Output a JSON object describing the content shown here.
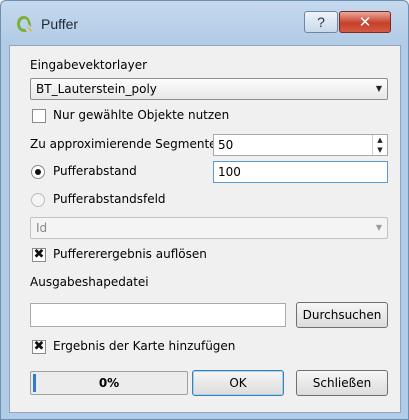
{
  "window": {
    "title": "Puffer",
    "help_label": "?",
    "close_label": "✕",
    "app_icon": "qgis-logo-icon"
  },
  "form": {
    "input_layer_label": "Eingabevektorlayer",
    "input_layer_value": "BT_Lauterstein_poly",
    "selected_only_label": "Nur gewählte Objekte nutzen",
    "selected_only_checked": false,
    "segments_label": "Zu approximierende Segmente",
    "segments_value": "50",
    "buffer_distance_label": "Pufferabstand",
    "buffer_distance_selected": true,
    "buffer_distance_value": "100",
    "buffer_field_label": "Pufferabstandsfeld",
    "buffer_field_selected": false,
    "buffer_field_value": "Id",
    "dissolve_label": "Puffererergebnis auflösen",
    "dissolve_checked": true,
    "output_label": "Ausgabeshapedatei",
    "output_value": "",
    "browse_label": "Durchsuchen",
    "add_to_map_label": "Ergebnis der Karte hinzufügen",
    "add_to_map_checked": true
  },
  "footer": {
    "progress_text": "0%",
    "progress_value": 0,
    "ok_label": "OK",
    "close_label": "Schließen"
  },
  "check_mark": "✖"
}
